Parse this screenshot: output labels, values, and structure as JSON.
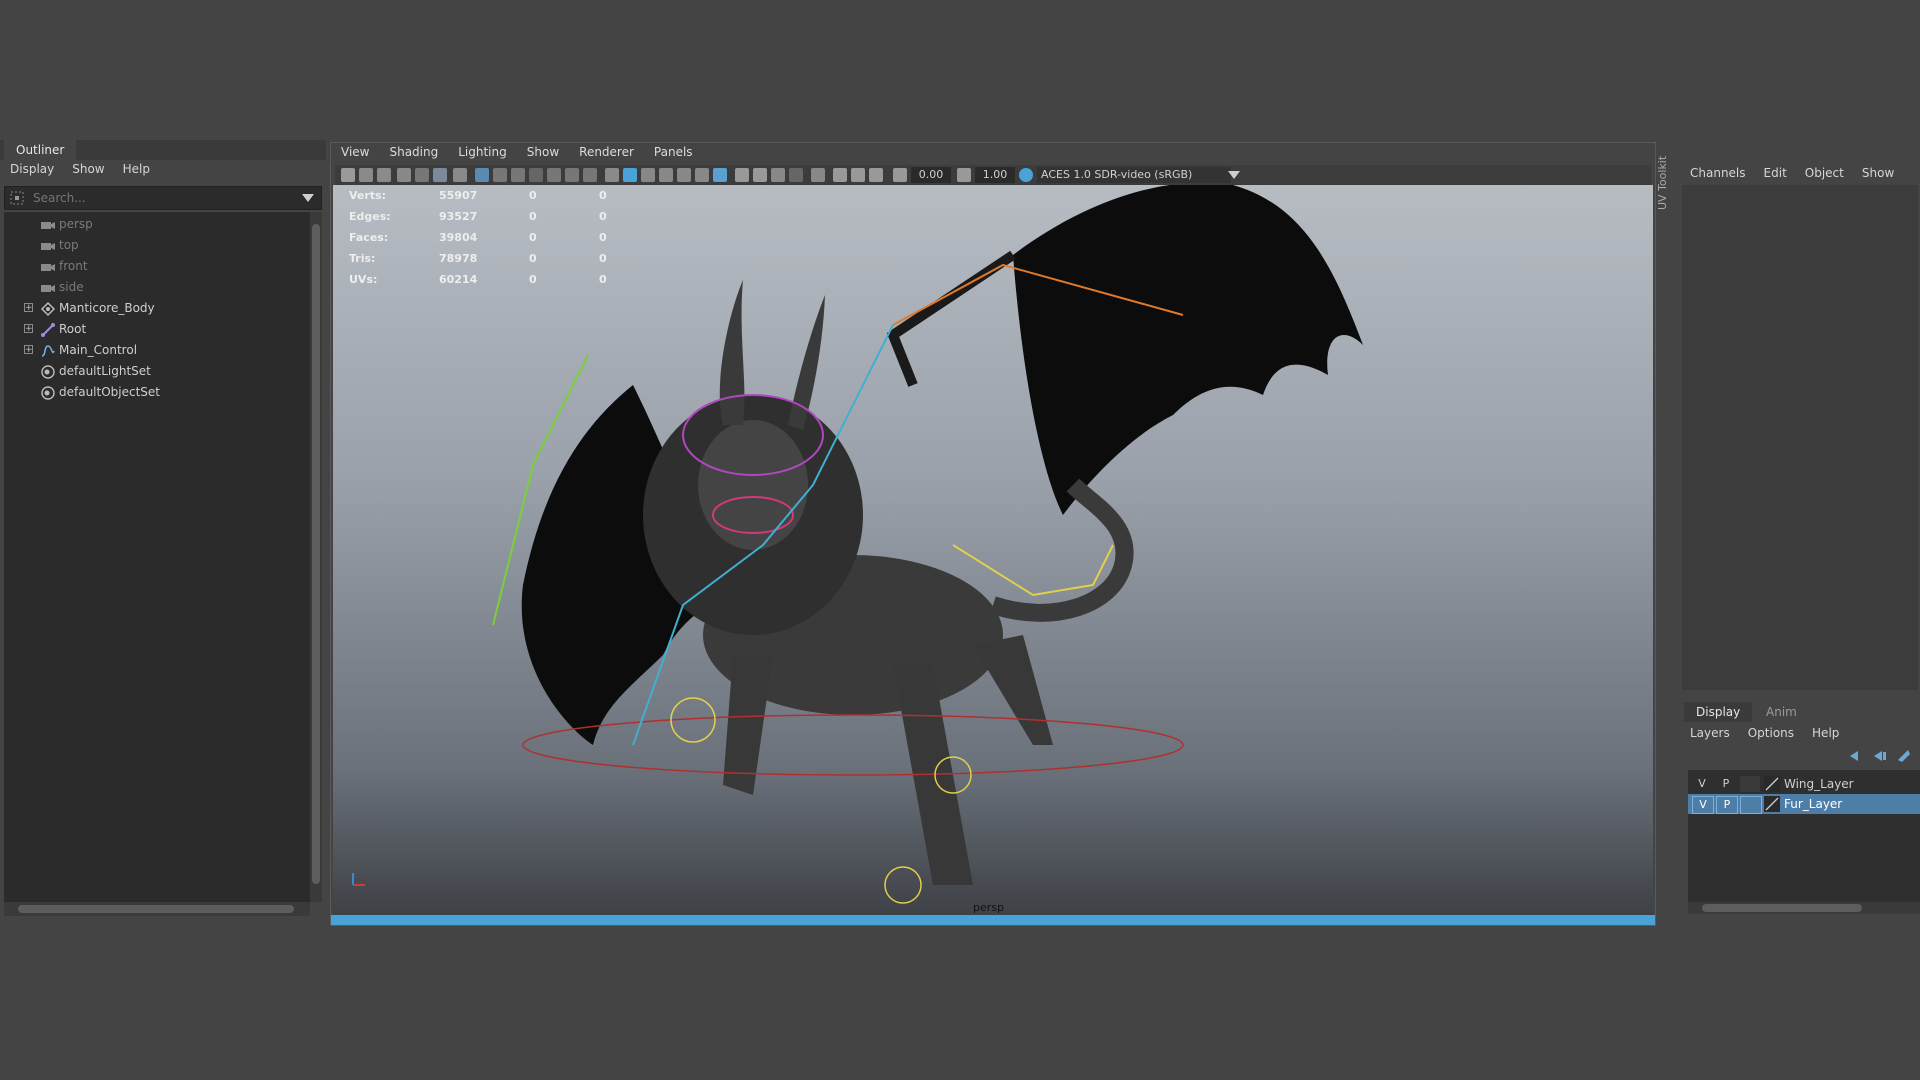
{
  "outliner": {
    "tab": "Outliner",
    "menu": [
      "Display",
      "Show",
      "Help"
    ],
    "search_placeholder": "Search...",
    "items": [
      {
        "label": "persp",
        "icon": "camera-icon"
      },
      {
        "label": "top",
        "icon": "camera-icon"
      },
      {
        "label": "front",
        "icon": "camera-icon"
      },
      {
        "label": "side",
        "icon": "camera-icon"
      },
      {
        "label": "Manticore_Body",
        "icon": "mesh-group-icon"
      },
      {
        "label": "Root",
        "icon": "joint-icon"
      },
      {
        "label": "Main_Control",
        "icon": "curve-icon"
      },
      {
        "label": "defaultLightSet",
        "icon": "set-icon"
      },
      {
        "label": "defaultObjectSet",
        "icon": "set-icon"
      }
    ]
  },
  "viewport": {
    "menu": [
      "View",
      "Shading",
      "Lighting",
      "Show",
      "Renderer",
      "Panels"
    ],
    "exposure": "0.00",
    "gamma": "1.00",
    "color_space": "ACES 1.0 SDR-video (sRGB)",
    "camera": "persp",
    "hud": [
      {
        "label": "Verts:",
        "v1": "55907",
        "v2": "0",
        "v3": "0"
      },
      {
        "label": "Edges:",
        "v1": "93527",
        "v2": "0",
        "v3": "0"
      },
      {
        "label": "Faces:",
        "v1": "39804",
        "v2": "0",
        "v3": "0"
      },
      {
        "label": "Tris:",
        "v1": "78978",
        "v2": "0",
        "v3": "0"
      },
      {
        "label": "UVs:",
        "v1": "60214",
        "v2": "0",
        "v3": "0"
      }
    ]
  },
  "uv_toolkit_label": "UV Toolkit",
  "channel_box": {
    "menu": [
      "Channels",
      "Edit",
      "Object",
      "Show"
    ]
  },
  "layer_editor": {
    "tabs": [
      "Display",
      "Anim"
    ],
    "menu": [
      "Layers",
      "Options",
      "Help"
    ],
    "layers": [
      {
        "v": "V",
        "p": "P",
        "name": "Wing_Layer",
        "selected": false
      },
      {
        "v": "V",
        "p": "P",
        "name": "Fur_Layer",
        "selected": true
      }
    ]
  },
  "colors": {
    "accent": "#4aa3d6",
    "selected_layer": "#4d7ea8",
    "panel_bg": "#444444"
  }
}
